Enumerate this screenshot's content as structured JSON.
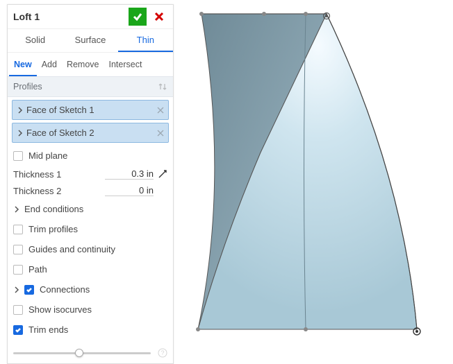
{
  "header": {
    "title": "Loft 1"
  },
  "tabs": {
    "items": [
      {
        "label": "Solid"
      },
      {
        "label": "Surface"
      },
      {
        "label": "Thin"
      }
    ],
    "active": "Thin"
  },
  "ops": {
    "items": [
      {
        "label": "New"
      },
      {
        "label": "Add"
      },
      {
        "label": "Remove"
      },
      {
        "label": "Intersect"
      }
    ],
    "active": "New"
  },
  "profiles": {
    "header": "Profiles",
    "items": [
      {
        "label": "Face of Sketch 1"
      },
      {
        "label": "Face of Sketch 2"
      }
    ]
  },
  "options": {
    "mid_plane": "Mid plane",
    "thickness1_label": "Thickness 1",
    "thickness1_value": "0.3 in",
    "thickness2_label": "Thickness 2",
    "thickness2_value": "0 in",
    "end_conditions": "End conditions",
    "trim_profiles": "Trim profiles",
    "guides": "Guides and continuity",
    "path": "Path",
    "connections": "Connections",
    "show_isocurves": "Show isocurves",
    "trim_ends": "Trim ends"
  }
}
